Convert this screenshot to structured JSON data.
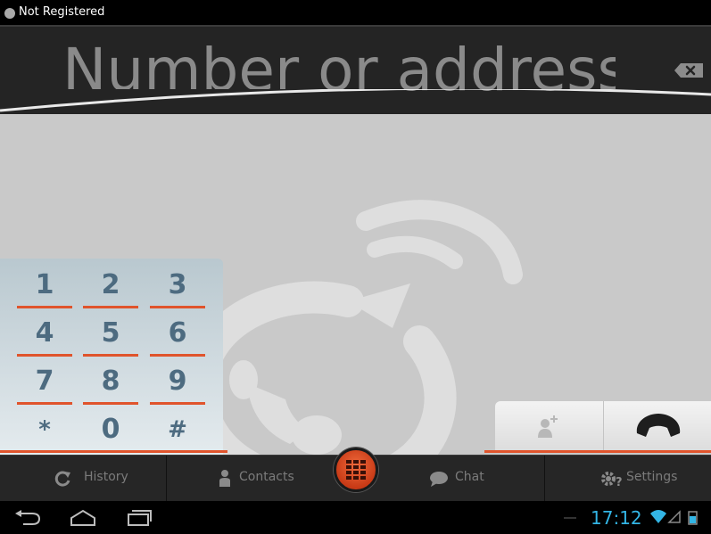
{
  "status": {
    "registration_text": "Not Registered"
  },
  "address": {
    "placeholder": "Number or address"
  },
  "dialpad": {
    "keys": [
      "1",
      "2",
      "3",
      "4",
      "5",
      "6",
      "7",
      "8",
      "9",
      "*",
      "0",
      "#"
    ]
  },
  "tabs": {
    "history": "History",
    "contacts": "Contacts",
    "chat": "Chat",
    "settings": "Settings"
  },
  "system": {
    "time": "17:12"
  },
  "colors": {
    "accent": "#e0542c",
    "clock": "#33b5e5",
    "key_text": "#4d6b80"
  },
  "icons": {
    "backspace": "backspace-icon",
    "add_contact": "add-contact-icon",
    "call": "phone-icon",
    "history": "refresh-icon",
    "contacts": "person-icon",
    "chat": "chat-bubble-icon",
    "settings": "gear-icon",
    "dialer": "dialpad-grid-icon"
  }
}
